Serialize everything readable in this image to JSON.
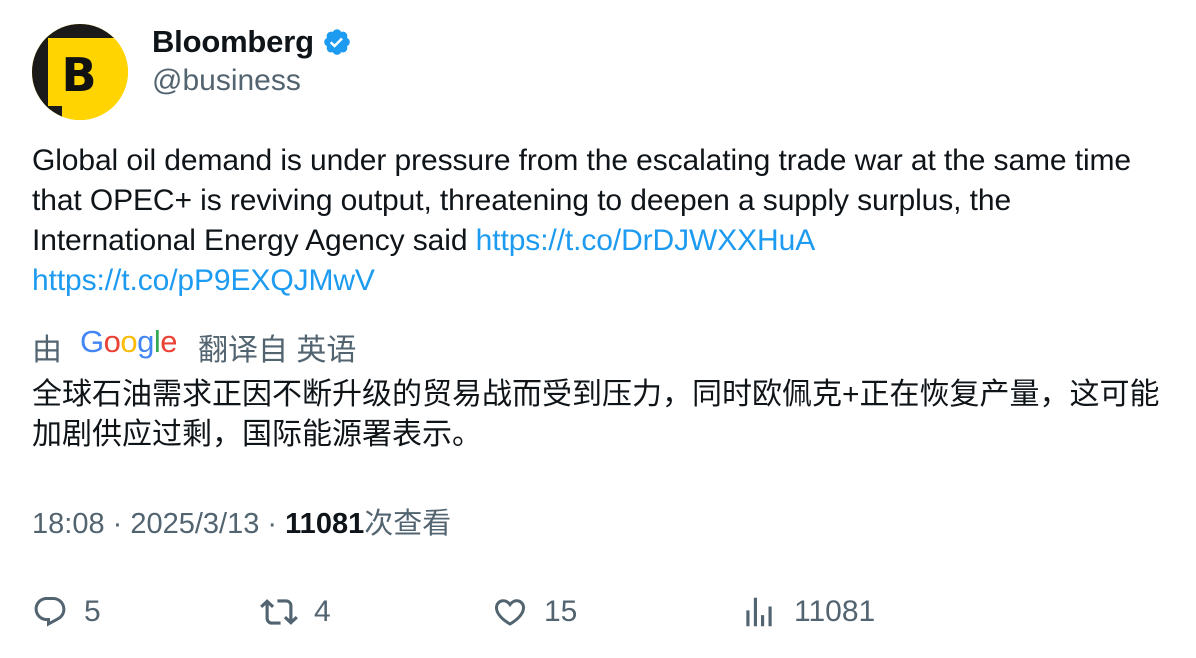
{
  "author": {
    "display_name": "Bloomberg",
    "handle": "@business",
    "avatar_letter": "B",
    "avatar_color": "#ffd400",
    "verified_icon": "verified-badge-icon",
    "verified_color": "#1d9bf0"
  },
  "tweet": {
    "text": "Global oil demand is under pressure from the escalating trade war at the same time that OPEC+ is reviving output, threatening to deepen a supply surplus, the International Energy Agency said ",
    "link1": "https://t.co/DrDJWXXHuA",
    "link2": "https://t.co/pP9EXQJMwV",
    "link_color": "#1d9bf0"
  },
  "translation": {
    "prefix": "由",
    "provider_logo": "Google",
    "suffix": "翻译自 英语",
    "text": "全球石油需求正因不断升级的贸易战而受到压力，同时欧佩克+正在恢复产量，这可能加剧供应过剩，国际能源署表示。"
  },
  "meta": {
    "time": "18:08",
    "separator": " · ",
    "date": "2025/3/13",
    "views_count": "11081",
    "views_label": "次查看"
  },
  "actions": {
    "replies": "5",
    "retweets": "4",
    "likes": "15",
    "views": "11081"
  }
}
